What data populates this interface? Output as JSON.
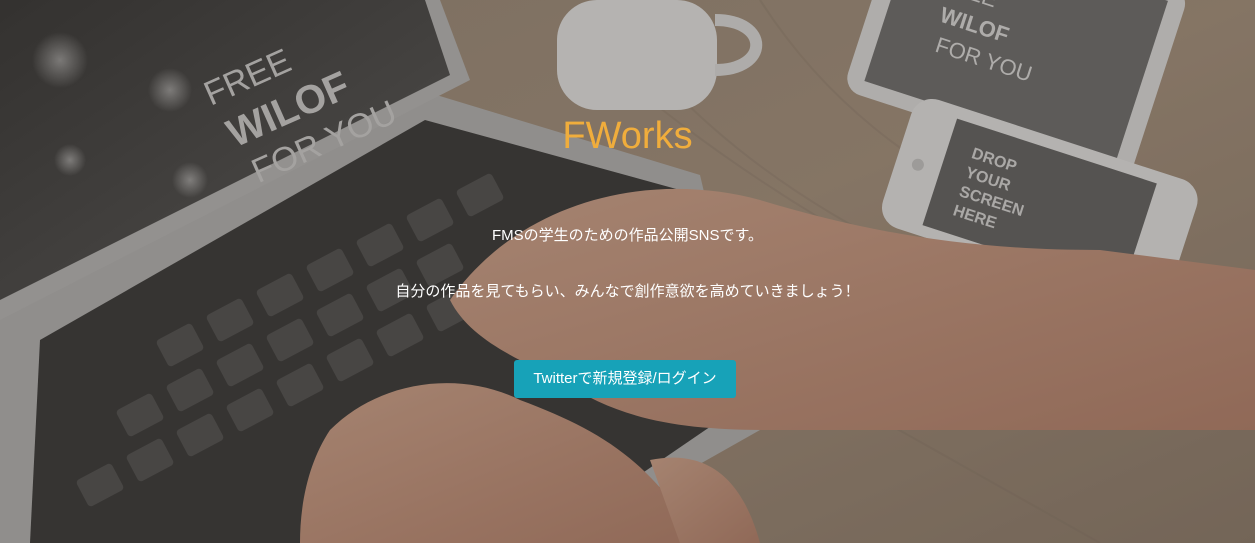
{
  "hero": {
    "title": "FWorks",
    "description_line1": "FMSの学生のための作品公開SNSです。",
    "description_line2": "自分の作品を見てもらい、みんなで創作意欲を高めていきましょう！",
    "cta_label": "Twitterで新規登録/ログイン",
    "background_image_text": {
      "laptop_screen": [
        "FREE",
        "WILOF",
        "FOR YOU"
      ],
      "tablet_screen": [
        "FREE",
        "WILOF",
        "FOR YOU"
      ],
      "phone_screen": [
        "DROP",
        "YOUR",
        "SCREEN",
        "HERE"
      ]
    }
  },
  "colors": {
    "title": "#f0ad3c",
    "text": "#ffffff",
    "cta_background": "#17a2b8"
  }
}
